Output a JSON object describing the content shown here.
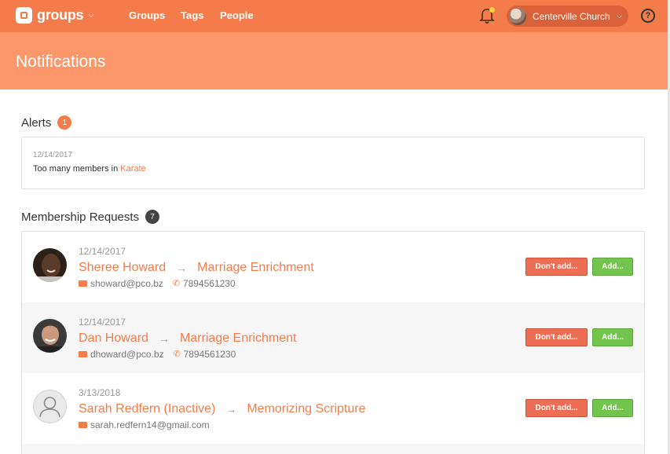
{
  "nav": {
    "logo_text": "groups",
    "links": [
      "Groups",
      "Tags",
      "People"
    ],
    "church": "Centerville Church",
    "help_label": "?"
  },
  "header": {
    "title": "Notifications"
  },
  "alerts": {
    "title": "Alerts",
    "count": "1",
    "count_color": "#f47c4a",
    "item": {
      "date": "12/14/2017",
      "text": "Too many members in ",
      "link": "Karate"
    }
  },
  "requests": {
    "title": "Membership Requests",
    "count": "7",
    "count_color": "#444444",
    "dont_add_label": "Don't add...",
    "add_label": "Add...",
    "items": [
      {
        "date": "12/14/2017",
        "name": "Sheree Howard",
        "group": "Marriage Enrichment",
        "email": "showard@pco.bz",
        "phone": "7894561230"
      },
      {
        "date": "12/14/2017",
        "name": "Dan Howard",
        "group": "Marriage Enrichment",
        "email": "dhoward@pco.bz",
        "phone": "7894561230"
      },
      {
        "date": "3/13/2018",
        "name": "Sarah Redfern (Inactive)",
        "group": "Memorizing Scripture",
        "email": "sarah.redfern14@gmail.com",
        "phone": ""
      }
    ]
  },
  "colors": {
    "accent": "#f47c4a",
    "header": "#fc9769",
    "danger": "#ee6e55",
    "success": "#73c44d"
  }
}
